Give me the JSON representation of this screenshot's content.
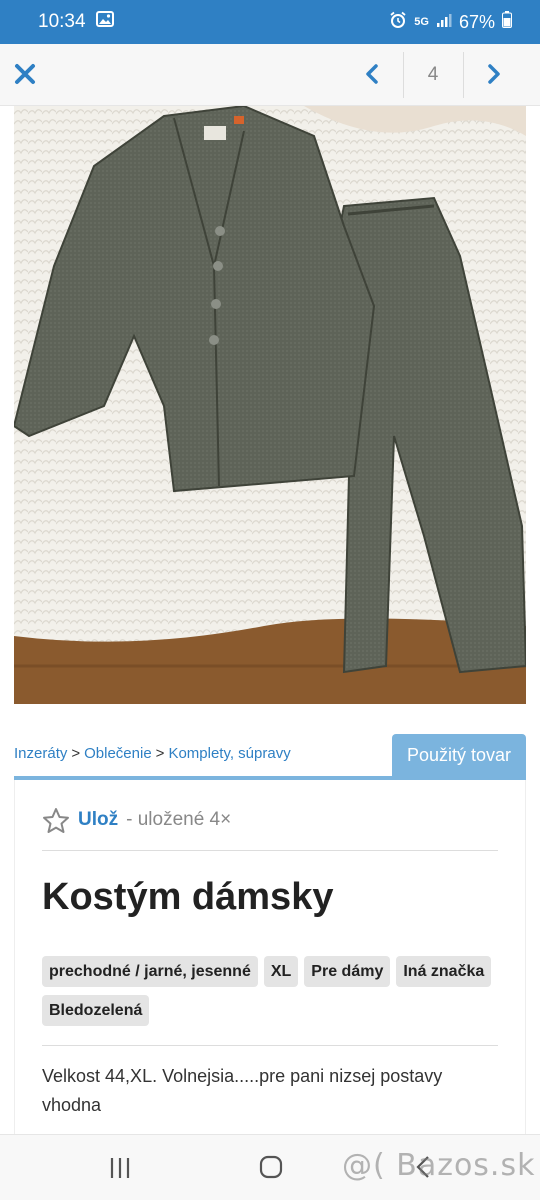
{
  "status_bar": {
    "time": "10:34",
    "network": "5G",
    "battery": "67%"
  },
  "nav": {
    "page_number": "4",
    "icons": [
      "close-icon",
      "chevron-left-icon",
      "chevron-right-icon"
    ]
  },
  "photo": {
    "subject": "gray-green women's suit: jacket and trousers on white fluffy rug",
    "colors": {
      "fabric": "#5e6358",
      "rug": "#f3f1ec",
      "floor": "#8a5a2e"
    }
  },
  "breadcrumb": {
    "items": [
      "Inzeráty",
      "Oblečenie",
      "Komplety, súpravy"
    ],
    "separator": ">"
  },
  "condition_tab": "Použitý tovar",
  "listing": {
    "save_label": "Ulož",
    "save_count": "- uložené 4×",
    "title": "Kostým dámsky",
    "tags": [
      "prechodné / jarné, jesenné",
      "XL",
      "Pre dámy",
      "Iná značka",
      "Bledozelená"
    ],
    "description": "Velkost 44,XL. Volnejsia.....pre pani nizsej postavy vhodna"
  },
  "watermark": "@( Bazos.sk",
  "colors": {
    "accent": "#2f80c4",
    "tab": "#7bb4de",
    "tag_bg": "#e4e4e4"
  }
}
